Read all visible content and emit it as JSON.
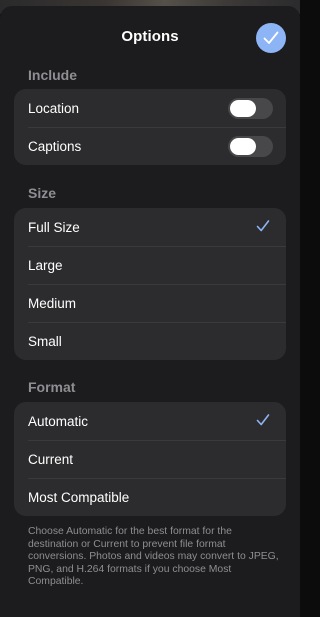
{
  "sheet": {
    "title": "Options",
    "done_label": "Done"
  },
  "include": {
    "label": "Include",
    "items": [
      {
        "label": "Location",
        "on": false
      },
      {
        "label": "Captions",
        "on": false
      }
    ]
  },
  "size": {
    "label": "Size",
    "items": [
      {
        "label": "Full Size",
        "selected": true
      },
      {
        "label": "Large",
        "selected": false
      },
      {
        "label": "Medium",
        "selected": false
      },
      {
        "label": "Small",
        "selected": false
      }
    ]
  },
  "format": {
    "label": "Format",
    "items": [
      {
        "label": "Automatic",
        "selected": true
      },
      {
        "label": "Current",
        "selected": false
      },
      {
        "label": "Most Compatible",
        "selected": false
      }
    ],
    "note": "Choose Automatic for the best format for the destination or Current to prevent file format conversions. Photos and videos may convert to JPEG, PNG, and H.264 formats if you choose Most Compatible."
  },
  "colors": {
    "accent": "#8db4f5",
    "sheet_bg": "#1c1c1e",
    "group_bg": "#2c2c2e",
    "secondary_text": "#8e8e93"
  },
  "icons": {
    "done": "checkmark-icon",
    "selected": "checkmark-icon"
  }
}
